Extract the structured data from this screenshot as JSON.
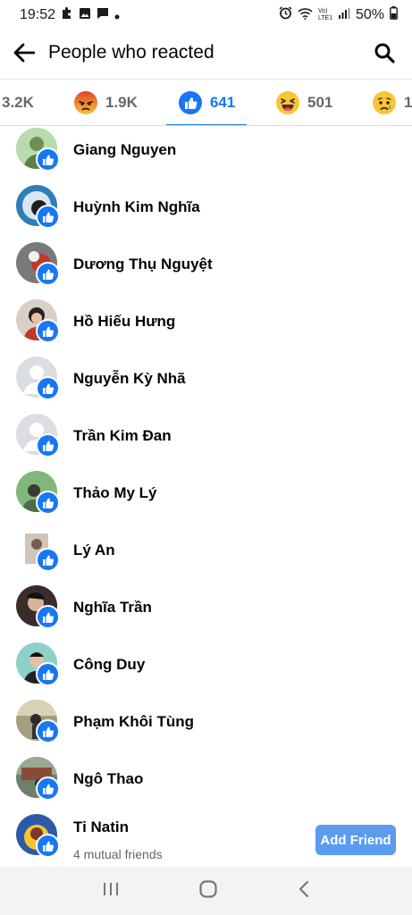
{
  "status": {
    "time": "19:52",
    "battery": "50%",
    "network_label": "Vo) LTE1"
  },
  "header": {
    "title": "People who reacted"
  },
  "tabs": [
    {
      "count": "3.2K",
      "reaction": "partial",
      "active": false
    },
    {
      "count": "1.9K",
      "reaction": "angry",
      "active": false
    },
    {
      "count": "641",
      "reaction": "like",
      "active": true
    },
    {
      "count": "501",
      "reaction": "haha",
      "active": false
    },
    {
      "count": "1",
      "reaction": "sad",
      "active": false
    }
  ],
  "people": [
    {
      "name": "Giang Nguyen",
      "avatar_color": "#9ccc9a"
    },
    {
      "name": "Huỳnh Kim Nghĩa",
      "avatar_color": "#2e7fb8"
    },
    {
      "name": "Dương Thụ Nguyệt",
      "avatar_color": "#6d6d6d"
    },
    {
      "name": "Hồ Hiếu Hưng",
      "avatar_color": "#b89a8a"
    },
    {
      "name": "Nguyễn Kỳ Nhã",
      "avatar_color": "#d8dadf"
    },
    {
      "name": "Trần Kim Đan",
      "avatar_color": "#d8dadf"
    },
    {
      "name": "Thảo My Lý",
      "avatar_color": "#6aa86c"
    },
    {
      "name": "Lý An",
      "avatar_color": "#c9c2b8"
    },
    {
      "name": "Nghĩa Trần",
      "avatar_color": "#3b2c2a"
    },
    {
      "name": "Công Duy",
      "avatar_color": "#7fc7c2"
    },
    {
      "name": "Phạm Khôi Tùng",
      "avatar_color": "#8f8a6d"
    },
    {
      "name": "Ngô Thao",
      "avatar_color": "#6e7f6a"
    },
    {
      "name": "Ti Natin",
      "avatar_color": "#2d59a8",
      "subtitle": "4 mutual friends",
      "action": "Add Friend"
    }
  ],
  "colors": {
    "accent": "#1877f2",
    "add_friend_bg": "#5b9bf0"
  }
}
